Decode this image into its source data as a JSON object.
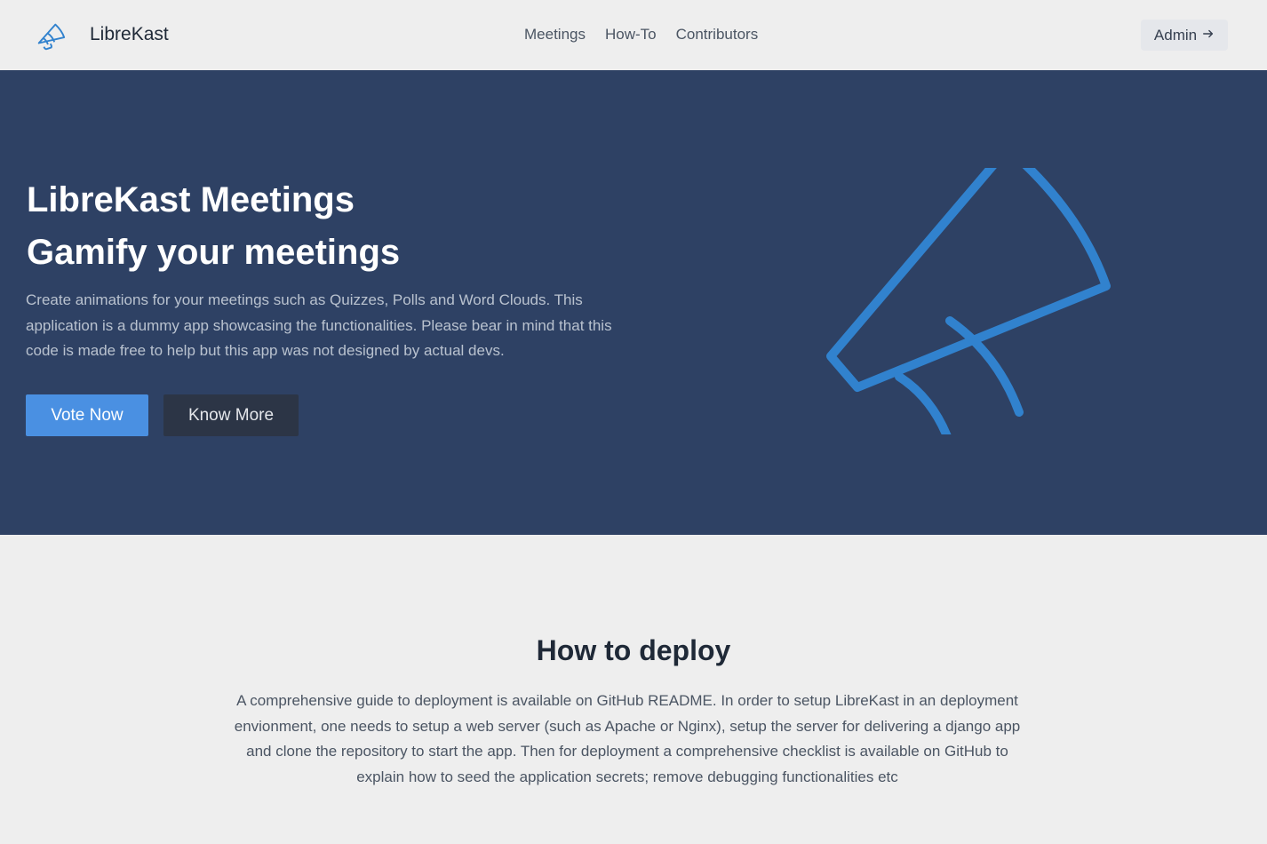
{
  "navbar": {
    "brand": "LibreKast",
    "links": [
      "Meetings",
      "How-To",
      "Contributors"
    ],
    "admin_label": "Admin",
    "admin_icon": "arrow-right-icon"
  },
  "hero": {
    "title_line1": "LibreKast Meetings",
    "title_line2": "Gamify your meetings",
    "description": "Create animations for your meetings such as Quizzes, Polls and Word Clouds. This application is a dummy app showcasing the functionalities. Please bear in mind that this code is made free to help but this app was not designed by actual devs.",
    "vote_label": "Vote Now",
    "more_label": "Know More",
    "illustration": "megaphone-icon"
  },
  "deploy": {
    "title": "How to deploy",
    "text": "A comprehensive guide to deployment is available on GitHub README. In order to setup LibreKast in an deployment envionment, one needs to setup a web server (such as Apache or Nginx), setup the server for delivering a django app and clone the repository to start the app. Then for deployment a comprehensive checklist is available on GitHub to explain how to seed the application secrets; remove debugging functionalities etc"
  },
  "colors": {
    "hero_bg": "#2e4164",
    "accent": "#4a90e2",
    "icon_blue": "#3182ce",
    "dark_button": "#2c3546",
    "page_bg": "#eeeeee"
  }
}
